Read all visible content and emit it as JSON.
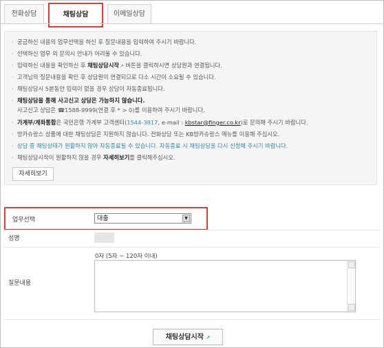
{
  "tabs": [
    {
      "label": "전화상담"
    },
    {
      "label": "채팅상담"
    },
    {
      "label": "이메일상담"
    }
  ],
  "notice": {
    "l1": "궁금하신 내용의 업무선택을 하신 후 질문내용을 입력하여 주시기 바랍니다.",
    "l2": "선택하신 업무 외 문의시 안내가 어려울 수 있습니다.",
    "l3a": "입력하신 내용을 확인하신 후 ",
    "l3b": "채팅상담시작",
    "l3c": " 버튼을 클릭하시면 상담원과 연결됩니다.",
    "l4": "고객님의 질문내용을 확인 후 상담원이 연결되므로 다소 시간이 소요될 수 있습니다.",
    "l5": "채팅상담시 5분동안 입력이 없을 경우 상담이 자동종료됩니다.",
    "l6a": "채팅상담을 통해 사고신고 상담은 가능하지 않습니다.",
    "l6b": "사고신고 상담은 ☎1588-9999(연결 후 * > 0)를 이용하여 주시기 바랍니다.",
    "l7a": "가계부/계좌통합",
    "l7b": "은 국민은행 가계부 고객센터(",
    "l7c": "1544-3817",
    "l7d": ", e-mail : ",
    "l7e": "kbstar@finger.co.kr",
    "l7f": ")로 문의해 주시기 바랍니다.",
    "l8": "방카슈랑스 상품에 대한 채팅상담은 지원하지 않습니다. 전화상담 또는 KB방카슈랑스 메뉴를 이용해 주십시오.",
    "l9": "상담 중 채팅상태가 원활하지 않아 자동종료될 수 있습니다. 자동종료 시 채팅상담을 다시 신청해 주시기 바랍니다.",
    "l10a": "채팅상담시작이 원활하지 않을 경우 ",
    "l10b": "자세히보기",
    "l10c": "를 클릭해주십시오.",
    "more_button": "자세히보기"
  },
  "form": {
    "business_label": "업무선택",
    "business_value": "대출",
    "name_label": "성명",
    "question_label": "질문내용",
    "count_text": "0자 (5자 ~ 120자 이내)"
  },
  "start_button": "채팅상담시작",
  "colors": {
    "highlight_border": "#e0373a",
    "info_blue": "#2a8bb5"
  }
}
